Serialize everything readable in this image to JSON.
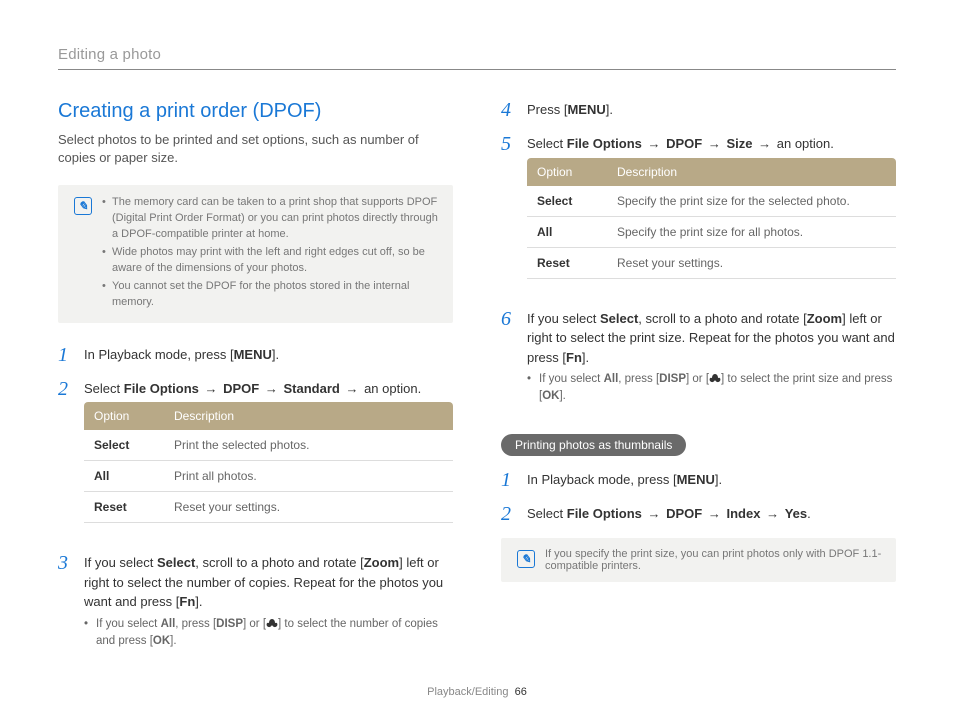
{
  "header": {
    "breadcrumb": "Editing a photo"
  },
  "section": {
    "title": "Creating a print order (DPOF)",
    "intro": "Select photos to be printed and set options, such as number of copies or paper size."
  },
  "note1": {
    "items": [
      "The memory card can be taken to a print shop that supports DPOF (Digital Print Order Format) or you can print photos directly through a DPOF-compatible printer at home.",
      "Wide photos may print with the left and right edges cut off, so be aware of the dimensions of your photos.",
      "You cannot set the DPOF for the photos stored in the internal memory."
    ]
  },
  "steps_left": {
    "s1": {
      "pre": "In Playback mode, press [",
      "key": "MENU",
      "post": "]."
    },
    "s2": {
      "pre": "Select ",
      "p1": "File Options",
      "p2": "DPOF",
      "p3": "Standard",
      "post": " an option."
    },
    "s3": {
      "line1a": "If you select ",
      "sel": "Select",
      "line1b": ", scroll to a photo and rotate [",
      "zoom": "Zoom",
      "line1c": "]",
      "line2a": "left or right to select the number of copies. Repeat for the photos you want and press [",
      "fn": "Fn",
      "line2b": "].",
      "bul_pre": "If you select ",
      "bul_all": "All",
      "bul_mid1": ", press [",
      "bul_disp": "DISP",
      "bul_mid2": "] or [",
      "bul_mid3": "] to select the number of copies and press [",
      "bul_ok": "OK",
      "bul_post": "]."
    }
  },
  "table1": {
    "h_opt": "Option",
    "h_desc": "Description",
    "rows": [
      {
        "o": "Select",
        "d": "Print the selected photos."
      },
      {
        "o": "All",
        "d": "Print all photos."
      },
      {
        "o": "Reset",
        "d": "Reset your settings."
      }
    ]
  },
  "steps_right": {
    "s4": {
      "pre": "Press [",
      "key": "MENU",
      "post": "]."
    },
    "s5": {
      "pre": "Select ",
      "p1": "File Options",
      "p2": "DPOF",
      "p3": "Size",
      "post": " an option."
    },
    "s6": {
      "line1a": "If you select ",
      "sel": "Select",
      "line1b": ", scroll to a photo and rotate [",
      "zoom": "Zoom",
      "line1c": "]",
      "line2a": "left or right to select the print size. Repeat for the photos you want and press [",
      "fn": "Fn",
      "line2b": "].",
      "bul_pre": "If you select ",
      "bul_all": "All",
      "bul_mid1": ", press [",
      "bul_disp": "DISP",
      "bul_mid2": "] or [",
      "bul_mid3": "] to select the print size and press [",
      "bul_ok": "OK",
      "bul_post": "]."
    }
  },
  "table2": {
    "h_opt": "Option",
    "h_desc": "Description",
    "rows": [
      {
        "o": "Select",
        "d": "Specify the print size for the selected photo."
      },
      {
        "o": "All",
        "d": "Specify the print size for all photos."
      },
      {
        "o": "Reset",
        "d": "Reset your settings."
      }
    ]
  },
  "subsection": {
    "pill": "Printing photos as thumbnails"
  },
  "steps_thumb": {
    "s1": {
      "pre": "In Playback mode, press [",
      "key": "MENU",
      "post": "]."
    },
    "s2": {
      "pre": "Select ",
      "p1": "File Options",
      "p2": "DPOF",
      "p3": "Index",
      "p4": "Yes",
      "post": "."
    }
  },
  "note2": {
    "text": "If you specify the print size, you can print photos only with DPOF 1.1-compatible printers."
  },
  "footer": {
    "section": "Playback/Editing",
    "page": "66"
  },
  "arrow_glyph": "→"
}
